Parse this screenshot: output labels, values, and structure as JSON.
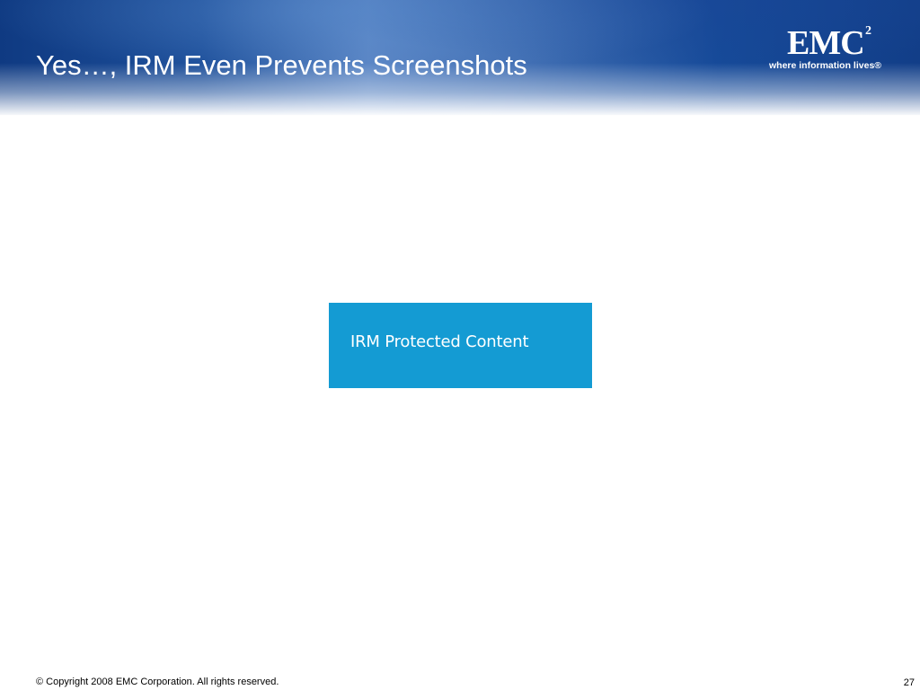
{
  "slide": {
    "title": "Yes…, IRM Even Prevents Screenshots",
    "logo": {
      "wordmark": "EMC",
      "superscript": "2",
      "tagline": "where information lives®"
    },
    "protected_box": {
      "label": "IRM Protected Content",
      "color": "#149bd3"
    },
    "footer": {
      "copyright": "© Copyright 2008 EMC Corporation. All rights reserved.",
      "page_number": "27"
    }
  },
  "colors": {
    "header_dark": "#0f3a82",
    "header_light": "#5b86c5",
    "text_light": "#ffffff",
    "text_dark": "#000000"
  }
}
